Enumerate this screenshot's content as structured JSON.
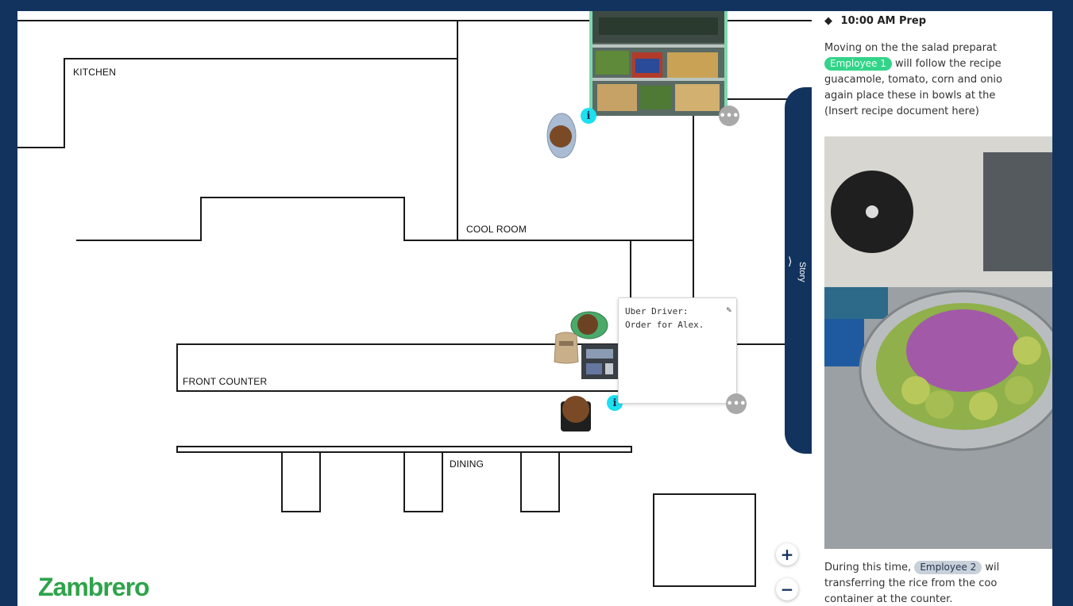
{
  "floorplan": {
    "rooms": {
      "kitchen": "KITCHEN",
      "cool_room": "COOL ROOM",
      "front_counter": "FRONT COUNTER",
      "dining": "DINING"
    },
    "note_card": {
      "text": "Uber Driver: Order for Alex."
    },
    "info_label": "i",
    "more_label": "•••",
    "zoom_in": "+",
    "zoom_out": "−",
    "story_tab_label": "Story",
    "brand": "Zambrero"
  },
  "story": {
    "header_icon": "◆",
    "header": "10:00 AM Prep",
    "para1_prefix": "Moving on the the salad preparat",
    "employee1": "Employee 1",
    "para1_line2_suffix": " will follow the recipe",
    "para1_line3": "guacamole, tomato, corn and onio",
    "para1_line4": "again place these in bowls at the",
    "para1_line5": "(Insert recipe document here)",
    "para2_prefix": "During this time, ",
    "employee2": "Employee 2",
    "para2_line1_suffix": " wil",
    "para2_line2": "transferring the rice from the coo",
    "para2_line3": "container at the counter."
  },
  "colors": {
    "frame": "#13335f",
    "info": "#1ce0f0",
    "employee1_chip": "#33d48a",
    "brand_green": "#2fa34a"
  }
}
